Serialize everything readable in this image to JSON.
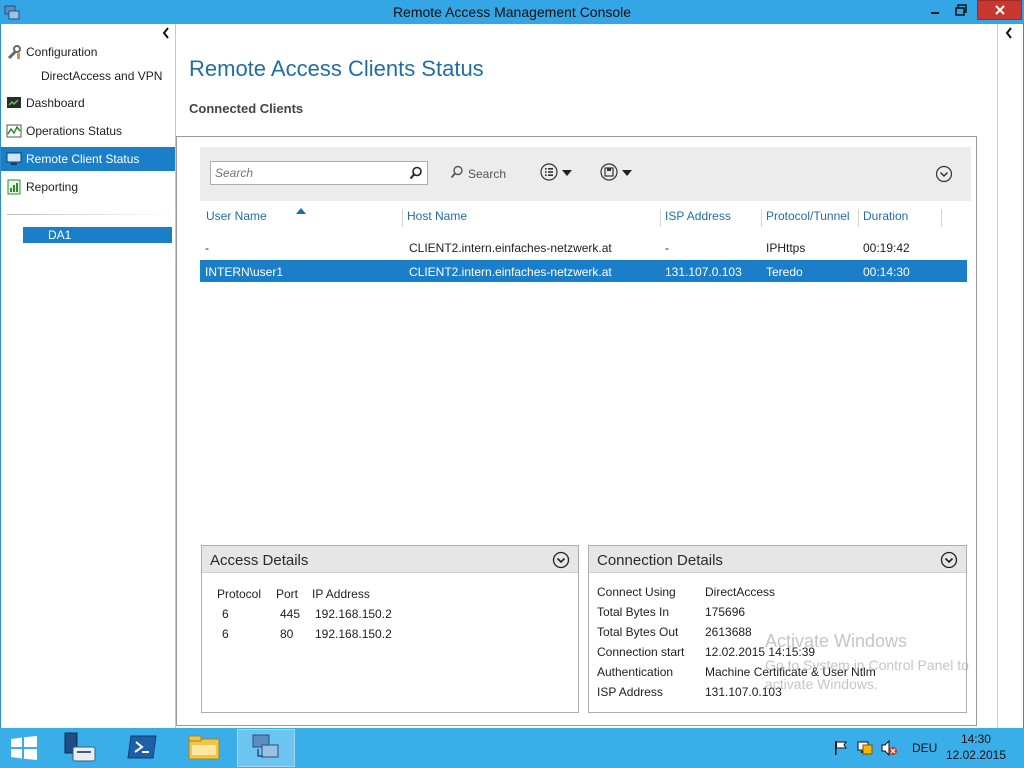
{
  "window": {
    "title": "Remote Access Management Console"
  },
  "sidebar": {
    "configuration_label": "Configuration",
    "configuration_sub": "DirectAccess and VPN",
    "items": [
      {
        "label": "Dashboard",
        "icon": "dashboard-icon"
      },
      {
        "label": "Operations Status",
        "icon": "operations-status-icon"
      },
      {
        "label": "Remote Client Status",
        "icon": "remote-client-icon",
        "selected": true
      },
      {
        "label": "Reporting",
        "icon": "reporting-icon"
      }
    ],
    "server": "DA1"
  },
  "main": {
    "page_title": "Remote Access Clients Status",
    "section_title": "Connected Clients",
    "search": {
      "placeholder": "Search",
      "button_label": "Search"
    },
    "columns": [
      "User Name",
      "Host Name",
      "ISP Address",
      "Protocol/Tunnel",
      "Duration"
    ],
    "rows": [
      {
        "user": "-",
        "host": "CLIENT2.intern.einfaches-netzwerk.at",
        "isp": "-",
        "protocol": "IPHttps",
        "duration": "00:19:42",
        "selected": false
      },
      {
        "user": "INTERN\\user1",
        "host": "CLIENT2.intern.einfaches-netzwerk.at",
        "isp": "131.107.0.103",
        "protocol": "Teredo",
        "duration": "00:14:30",
        "selected": true
      }
    ]
  },
  "access_details": {
    "title": "Access Details",
    "headers": [
      "Protocol",
      "Port",
      "IP Address"
    ],
    "rows": [
      {
        "protocol": "6",
        "port": "445",
        "ip": "192.168.150.2"
      },
      {
        "protocol": "6",
        "port": "80",
        "ip": "192.168.150.2"
      }
    ]
  },
  "connection_details": {
    "title": "Connection Details",
    "fields": [
      {
        "label": "Connect Using",
        "value": "DirectAccess"
      },
      {
        "label": "Total Bytes In",
        "value": "175696"
      },
      {
        "label": "Total Bytes Out",
        "value": "2613688"
      },
      {
        "label": "Connection start",
        "value": "12.02.2015 14:15:39"
      },
      {
        "label": "Authentication",
        "value": "Machine Certificate & User Ntlm"
      },
      {
        "label": "ISP Address",
        "value": "131.107.0.103"
      }
    ]
  },
  "watermark": {
    "line1": "Activate Windows",
    "line2": "Go to System in Control Panel to",
    "line3": "activate Windows."
  },
  "taskbar": {
    "language": "DEU",
    "time": "14:30",
    "date": "12.02.2015"
  },
  "colors": {
    "accent": "#1a7ec8",
    "title_blue": "#1f6ea6",
    "taskbar": "#3aaee8"
  }
}
